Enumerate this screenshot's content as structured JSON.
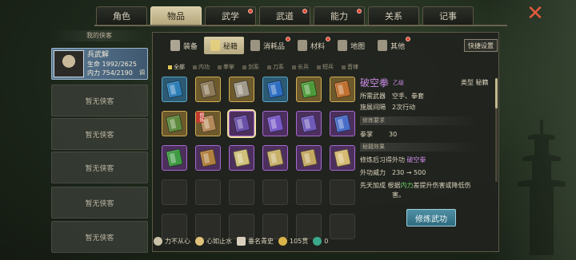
{
  "tabs": [
    {
      "label": "角色",
      "active": false,
      "dot": false
    },
    {
      "label": "物品",
      "active": true,
      "dot": false
    },
    {
      "label": "武学",
      "active": false,
      "dot": true
    },
    {
      "label": "武道",
      "active": false,
      "dot": true
    },
    {
      "label": "能力",
      "active": false,
      "dot": true
    },
    {
      "label": "关系",
      "active": false,
      "dot": false
    },
    {
      "label": "记事",
      "active": false,
      "dot": false
    }
  ],
  "sidebar": {
    "header": "我的侠客",
    "character": {
      "name": "兵武解",
      "hp": "生命 1992/2625",
      "mp": "内力 754/2190",
      "tip": "调"
    },
    "empty_label": "暂无侠客"
  },
  "subtabs": [
    {
      "label": "装备",
      "icon": "sword-icon",
      "active": false,
      "dot": false
    },
    {
      "label": "秘籍",
      "icon": "book-icon",
      "active": true,
      "dot": false
    },
    {
      "label": "消耗品",
      "icon": "potion-icon",
      "active": false,
      "dot": true
    },
    {
      "label": "材料",
      "icon": "material-icon",
      "active": false,
      "dot": true
    },
    {
      "label": "地图",
      "icon": "map-icon",
      "active": false,
      "dot": false
    },
    {
      "label": "其他",
      "icon": "other-icon",
      "active": false,
      "dot": true
    }
  ],
  "quick_settings": "快捷设置",
  "filters": [
    {
      "label": "全部",
      "on": true
    },
    {
      "label": "内功",
      "on": false
    },
    {
      "label": "拳掌",
      "on": false
    },
    {
      "label": "剑系",
      "on": false
    },
    {
      "label": "刀系",
      "on": false
    },
    {
      "label": "长兵",
      "on": false
    },
    {
      "label": "短兵",
      "on": false
    },
    {
      "label": "音律",
      "on": false
    }
  ],
  "items": [
    {
      "quality": "blue",
      "book": "#2e7fb8"
    },
    {
      "quality": "gold",
      "book": "#8c7a5a"
    },
    {
      "quality": "gold",
      "book": "#a09a8a"
    },
    {
      "quality": "blue",
      "book": "#2d6ec2"
    },
    {
      "quality": "gold",
      "book": "#4e9a3a"
    },
    {
      "quality": "gold",
      "book": "#c07030"
    },
    {
      "quality": "gold",
      "book": "#5e8a3e"
    },
    {
      "quality": "gold",
      "book": "#b58a5a",
      "tag": "修炼"
    },
    {
      "quality": "purple",
      "book": "#6a4fa8",
      "selected": true
    },
    {
      "quality": "purple",
      "book": "#7a5ac8"
    },
    {
      "quality": "purple",
      "book": "#6f5ab8"
    },
    {
      "quality": "purple",
      "book": "#4a6ec8"
    },
    {
      "quality": "purple",
      "book": "#3f9a44"
    },
    {
      "quality": "purple",
      "book": "#b0803e"
    },
    {
      "quality": "purple",
      "book": "#d0c27a"
    },
    {
      "quality": "purple",
      "book": "#c7b06a"
    },
    {
      "quality": "purple",
      "book": "#c4a862"
    },
    {
      "quality": "purple",
      "book": "#d6ba72"
    },
    {},
    {},
    {},
    {},
    {},
    {},
    {},
    {},
    {},
    {},
    {},
    {}
  ],
  "detail": {
    "title": "破空拳",
    "grade": "乙级",
    "type_label": "类型",
    "type_value": "秘籍",
    "weapon_label": "所需武器",
    "weapon_value": "空手、拳套",
    "interval_label": "施展间隔",
    "interval_value": "2次行动",
    "req_header": "修炼要求",
    "req_skill": "拳掌",
    "req_value": "30",
    "effect_header": "秘籍效果",
    "effect_line_prefix": "修炼后习得外功",
    "effect_line_skill": "破空拳",
    "power_label": "外功威力",
    "power_value": "230 → 500",
    "innate_label": "先天加成",
    "innate_pre": "根据",
    "innate_attr": "内力",
    "innate_post": "差提升伤害或降低伤",
    "innate_post2": "害。",
    "button": "修炼武功"
  },
  "status": {
    "trait1": "力不从心",
    "trait2": "心如止水",
    "fame": "垂名青史",
    "money": "105贯",
    "gems": "0"
  },
  "colors": {
    "accent": "#c98be6",
    "buff": "#6fd06a",
    "alert": "#e04a36"
  }
}
